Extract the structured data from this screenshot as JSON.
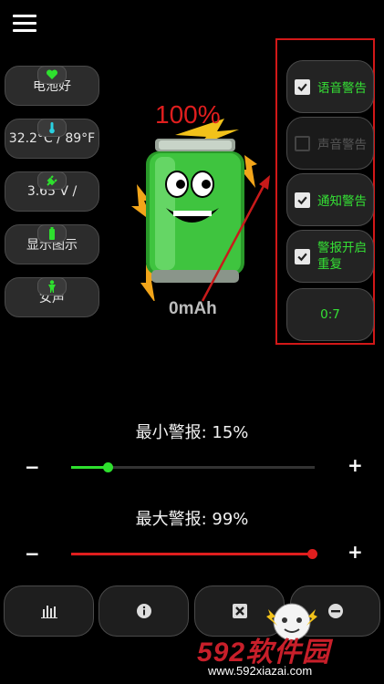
{
  "header": {
    "menu_icon": "hamburger-menu-icon"
  },
  "left_cards": [
    {
      "icon": "heart-icon",
      "icon_color": "#2ee02e",
      "label": "电池好"
    },
    {
      "icon": "thermometer-icon",
      "icon_color": "#2ad0e0",
      "label": "32.2°C / 89°F"
    },
    {
      "icon": "plug-icon",
      "icon_color": "#2ee02e",
      "label": "3.65 V /"
    },
    {
      "icon": "battery-small-icon",
      "icon_color": "#2ee02e",
      "label": "显示图示"
    },
    {
      "icon": "person-icon",
      "icon_color": "#2ee02e",
      "label": "女声"
    }
  ],
  "battery": {
    "percent": "100%",
    "capacity": "0mAh"
  },
  "alerts": [
    {
      "label": "语音警告",
      "checked": true,
      "enabled": true
    },
    {
      "label": "声音警告",
      "checked": false,
      "enabled": false
    },
    {
      "label": "通知警告",
      "checked": true,
      "enabled": true
    },
    {
      "label": "警报开启重复",
      "checked": true,
      "enabled": true
    }
  ],
  "time_button": {
    "label": "0:7"
  },
  "sliders": {
    "min": {
      "label": "最小警报: 15%",
      "value_percent": 15,
      "color": "#2ee02e",
      "minus": "−",
      "plus": "+"
    },
    "max": {
      "label": "最大警报: 99%",
      "value_percent": 99,
      "color": "#e01e1e",
      "minus": "−",
      "plus": "+"
    }
  },
  "bottom_buttons": [
    {
      "icon": "bar-chart-icon"
    },
    {
      "icon": "info-icon"
    },
    {
      "icon": "close-box-icon"
    },
    {
      "icon": "minus-circle-icon"
    }
  ],
  "watermark": {
    "brand": "592软件园",
    "url": "www.592xiazai.com"
  },
  "colors": {
    "accent_green": "#2ee02e",
    "alert_red": "#d21818"
  }
}
